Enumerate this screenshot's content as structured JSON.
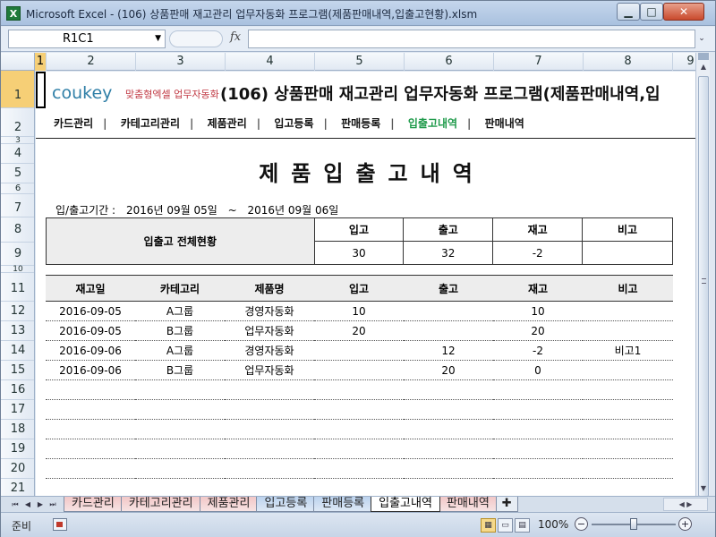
{
  "window": {
    "title": "Microsoft Excel - (106) 상품판매 재고관리 업무자동화 프로그램(제품판매내역,입출고현황).xlsm",
    "app_icon": "X",
    "minimize_glyph": "▁",
    "maximize_glyph": "□",
    "close_glyph": "✕"
  },
  "formula_bar": {
    "name_box": "R1C1",
    "dropdown_glyph": "▼",
    "fx_label": "fx",
    "formula_value": "",
    "expand_glyph": "⌄"
  },
  "columns": [
    "1",
    "2",
    "3",
    "4",
    "5",
    "6",
    "7",
    "8",
    "9"
  ],
  "rows": [
    "1",
    "2",
    "3",
    "4",
    "5",
    "6",
    "7",
    "8",
    "9",
    "10",
    "11",
    "12",
    "13",
    "14",
    "15",
    "16",
    "17",
    "18",
    "19",
    "20",
    "21"
  ],
  "header": {
    "logo_main": "coukey",
    "logo_sub": "맞춤형엑셀 업무자동화",
    "title": "(106) 상품판매 재고관리 업무자동화 프로그램(제품판매내역,입"
  },
  "menu": {
    "items": [
      {
        "label": "카드관리"
      },
      {
        "label": "카테고리관리"
      },
      {
        "label": "제품관리"
      },
      {
        "label": "입고등록"
      },
      {
        "label": "판매등록"
      },
      {
        "label": "입출고내역"
      },
      {
        "label": "판매내역"
      }
    ],
    "active_index": 5,
    "separator": "|"
  },
  "main_title": "제품입출고내역",
  "period": {
    "label": "입/출고기간 :",
    "start": "2016년 09월 05일",
    "tilde": "~",
    "end": "2016년 09월 06일"
  },
  "summary": {
    "label": "입출고 전체현황",
    "headers": [
      "입고",
      "출고",
      "재고",
      "비고"
    ],
    "values": [
      "30",
      "32",
      "-2",
      ""
    ]
  },
  "detail": {
    "headers": [
      "재고일",
      "카테고리",
      "제품명",
      "입고",
      "출고",
      "재고",
      "비고"
    ],
    "rows": [
      [
        "2016-09-05",
        "A그룹",
        "경영자동화",
        "10",
        "",
        "10",
        ""
      ],
      [
        "2016-09-05",
        "B그룹",
        "업무자동화",
        "20",
        "",
        "20",
        ""
      ],
      [
        "2016-09-06",
        "A그룹",
        "경영자동화",
        "",
        "12",
        "-2",
        "비고1"
      ],
      [
        "2016-09-06",
        "B그룹",
        "업무자동화",
        "",
        "20",
        "0",
        ""
      ],
      [
        "",
        "",
        "",
        "",
        "",
        "",
        ""
      ],
      [
        "",
        "",
        "",
        "",
        "",
        "",
        ""
      ],
      [
        "",
        "",
        "",
        "",
        "",
        "",
        ""
      ],
      [
        "",
        "",
        "",
        "",
        "",
        "",
        ""
      ],
      [
        "",
        "",
        "",
        "",
        "",
        "",
        ""
      ]
    ]
  },
  "sheet_tabs": {
    "items": [
      {
        "label": "카드관리"
      },
      {
        "label": "카테고리관리"
      },
      {
        "label": "제품관리"
      },
      {
        "label": "입고등록"
      },
      {
        "label": "판매등록"
      },
      {
        "label": "입출고내역"
      },
      {
        "label": "판매내역"
      }
    ],
    "active_index": 5
  },
  "status": {
    "ready": "준비",
    "zoom": "100%",
    "zoom_minus": "−",
    "zoom_plus": "+"
  },
  "colors": {
    "menu_active": "#1e9a4a",
    "logo": "#2f7fa7",
    "logo_sub": "#c13a44",
    "header_fill": "#ededed"
  }
}
